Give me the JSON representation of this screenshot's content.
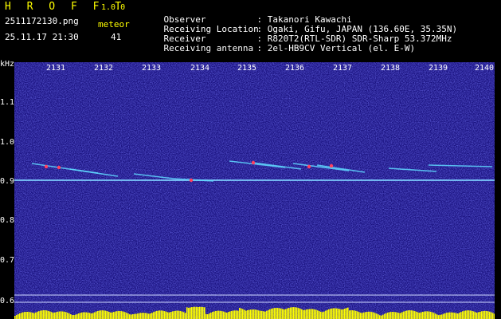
{
  "header": {
    "app_title": "H R O F F T",
    "version": "1.0.0",
    "filename": "2511172130.png",
    "meteor_label": "meteor",
    "datetime": "25.11.17 21:30",
    "meteor_count": "41"
  },
  "info": [
    {
      "key": "Observer",
      "value": ": Takanori Kawachi"
    },
    {
      "key": "Receiving Location",
      "value": ": Ogaki, Gifu, JAPAN (136.60E, 35.35N)"
    },
    {
      "key": "Receiver",
      "value": ": R820T2(RTL-SDR) SDR-Sharp 53.372MHz"
    },
    {
      "key": "Receiving antenna",
      "value": ": 2el-HB9CV Vertical (el. E-W)"
    }
  ],
  "axes": {
    "y_unit": "kHz",
    "y_ticks": [
      "1.1",
      "1.0",
      "0.9",
      "0.8",
      "0.7",
      "0.6"
    ],
    "x_ticks": [
      "2131",
      "2132",
      "2133",
      "2134",
      "2135",
      "2136",
      "2137",
      "2138",
      "2139",
      "2140"
    ]
  },
  "colors": {
    "background": "#1a1280",
    "carrier": "#7fd0ff",
    "meteor": "#ff4060",
    "level": "#ffff00"
  }
}
